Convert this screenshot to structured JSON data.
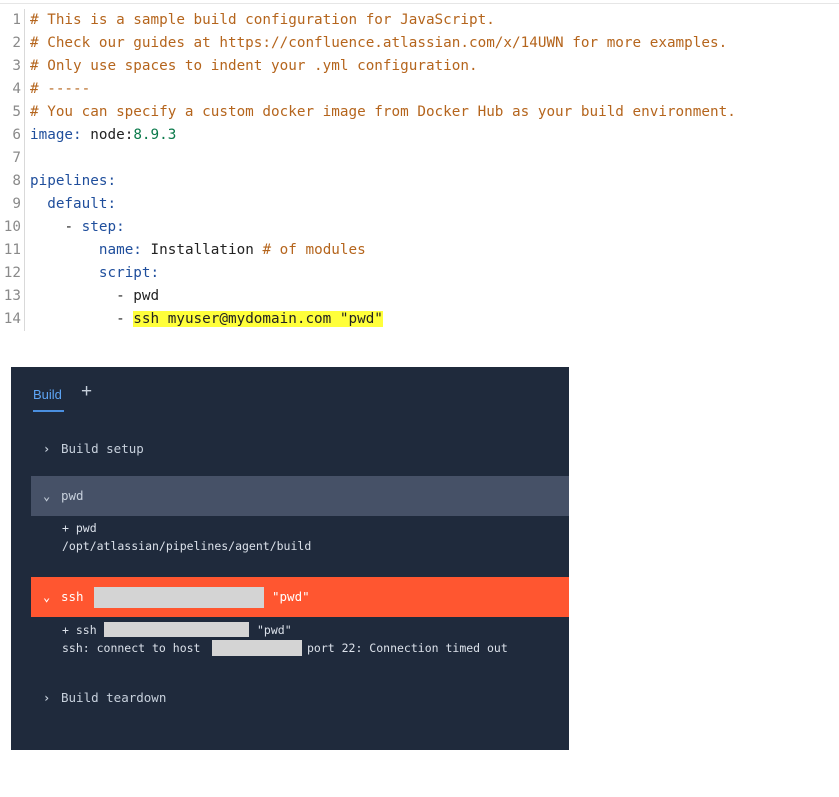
{
  "editor": {
    "lines": [
      {
        "num": "1",
        "comment": "# This is a sample build configuration for JavaScript."
      },
      {
        "num": "2",
        "comment": "# Check our guides at https://confluence.atlassian.com/x/14UWN for more examples."
      },
      {
        "num": "3",
        "comment": "# Only use spaces to indent your .yml configuration."
      },
      {
        "num": "4",
        "comment": "# -----"
      },
      {
        "num": "5",
        "comment": "# You can specify a custom docker image from Docker Hub as your build environment."
      },
      {
        "num": "6",
        "key": "image:",
        "value": "node:",
        "number": "8.9.3"
      },
      {
        "num": "7"
      },
      {
        "num": "8",
        "key": "pipelines:"
      },
      {
        "num": "9",
        "key": "default:"
      },
      {
        "num": "10",
        "dash": "- ",
        "key": "step:"
      },
      {
        "num": "11",
        "key": "name:",
        "value": "Installation ",
        "comment": "# of modules"
      },
      {
        "num": "12",
        "key": "script:"
      },
      {
        "num": "13",
        "dash": "- ",
        "value": "pwd"
      },
      {
        "num": "14",
        "dash": "- ",
        "highlight": "ssh myuser@mydomain.com \"pwd\""
      }
    ]
  },
  "pipeline": {
    "tab_label": "Build",
    "add_label": "+",
    "steps": {
      "setup": {
        "label": "Build setup",
        "chevron": "›"
      },
      "pwd": {
        "label": "pwd",
        "chevron": "⌄",
        "output": [
          "+ pwd",
          "/opt/atlassian/pipelines/agent/build"
        ]
      },
      "ssh": {
        "label": "ssh",
        "suffix": "\"pwd\"",
        "chevron": "⌄",
        "cmd_prefix": "+ ssh",
        "cmd_suffix": "\"pwd\"",
        "err_prefix": "ssh: connect to host",
        "err_suffix": "port 22: Connection timed out"
      },
      "teardown": {
        "label": "Build teardown",
        "chevron": "›"
      }
    }
  }
}
